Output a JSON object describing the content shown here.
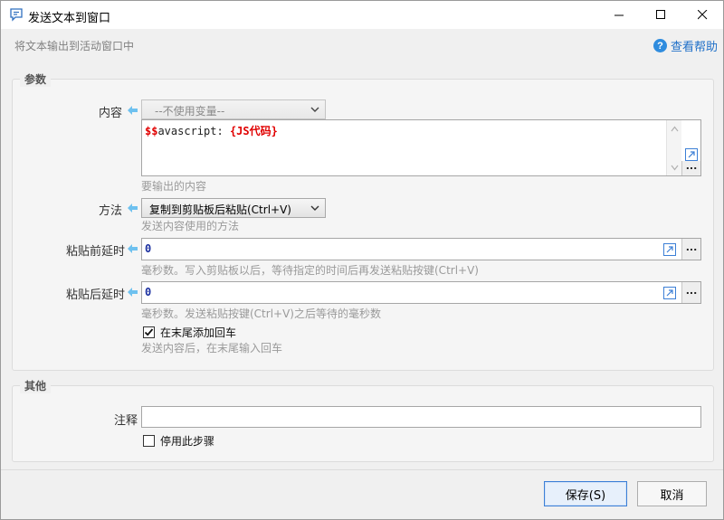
{
  "window": {
    "title": "发送文本到窗口",
    "subtitle": "将文本输出到活动窗口中",
    "help_label": "查看帮助"
  },
  "params_group": {
    "legend": "参数",
    "content": {
      "label": "内容",
      "variable_select": "--不使用变量--",
      "code_prefix": "$$",
      "code_text": "avascript: ",
      "code_placeholder": "{JS代码}",
      "hint": "要输出的内容"
    },
    "method": {
      "label": "方法",
      "selected": "复制到剪贴板后粘贴(Ctrl+V)",
      "hint": "发送内容使用的方法"
    },
    "pre_delay": {
      "label": "粘贴前延时",
      "value": "0",
      "hint": "毫秒数。写入剪贴板以后，等待指定的时间后再发送粘贴按键(Ctrl+V)"
    },
    "post_delay": {
      "label": "粘贴后延时",
      "value": "0",
      "hint": "毫秒数。发送粘贴按键(Ctrl+V)之后等待的毫秒数"
    },
    "append_enter": {
      "label": "在末尾添加回车",
      "checked": true,
      "hint": "发送内容后，在末尾输入回车"
    }
  },
  "other_group": {
    "legend": "其他",
    "note_label": "注释",
    "note_value": "",
    "disable_label": "停用此步骤",
    "disable_checked": false
  },
  "buttons": {
    "save": "保存(S)",
    "cancel": "取消",
    "ellipsis": "..."
  },
  "colors": {
    "accent": "#3c7fd6",
    "arrow": "#6ec1ef",
    "code_red": "#e00000",
    "number_blue": "#1a2fa0"
  }
}
